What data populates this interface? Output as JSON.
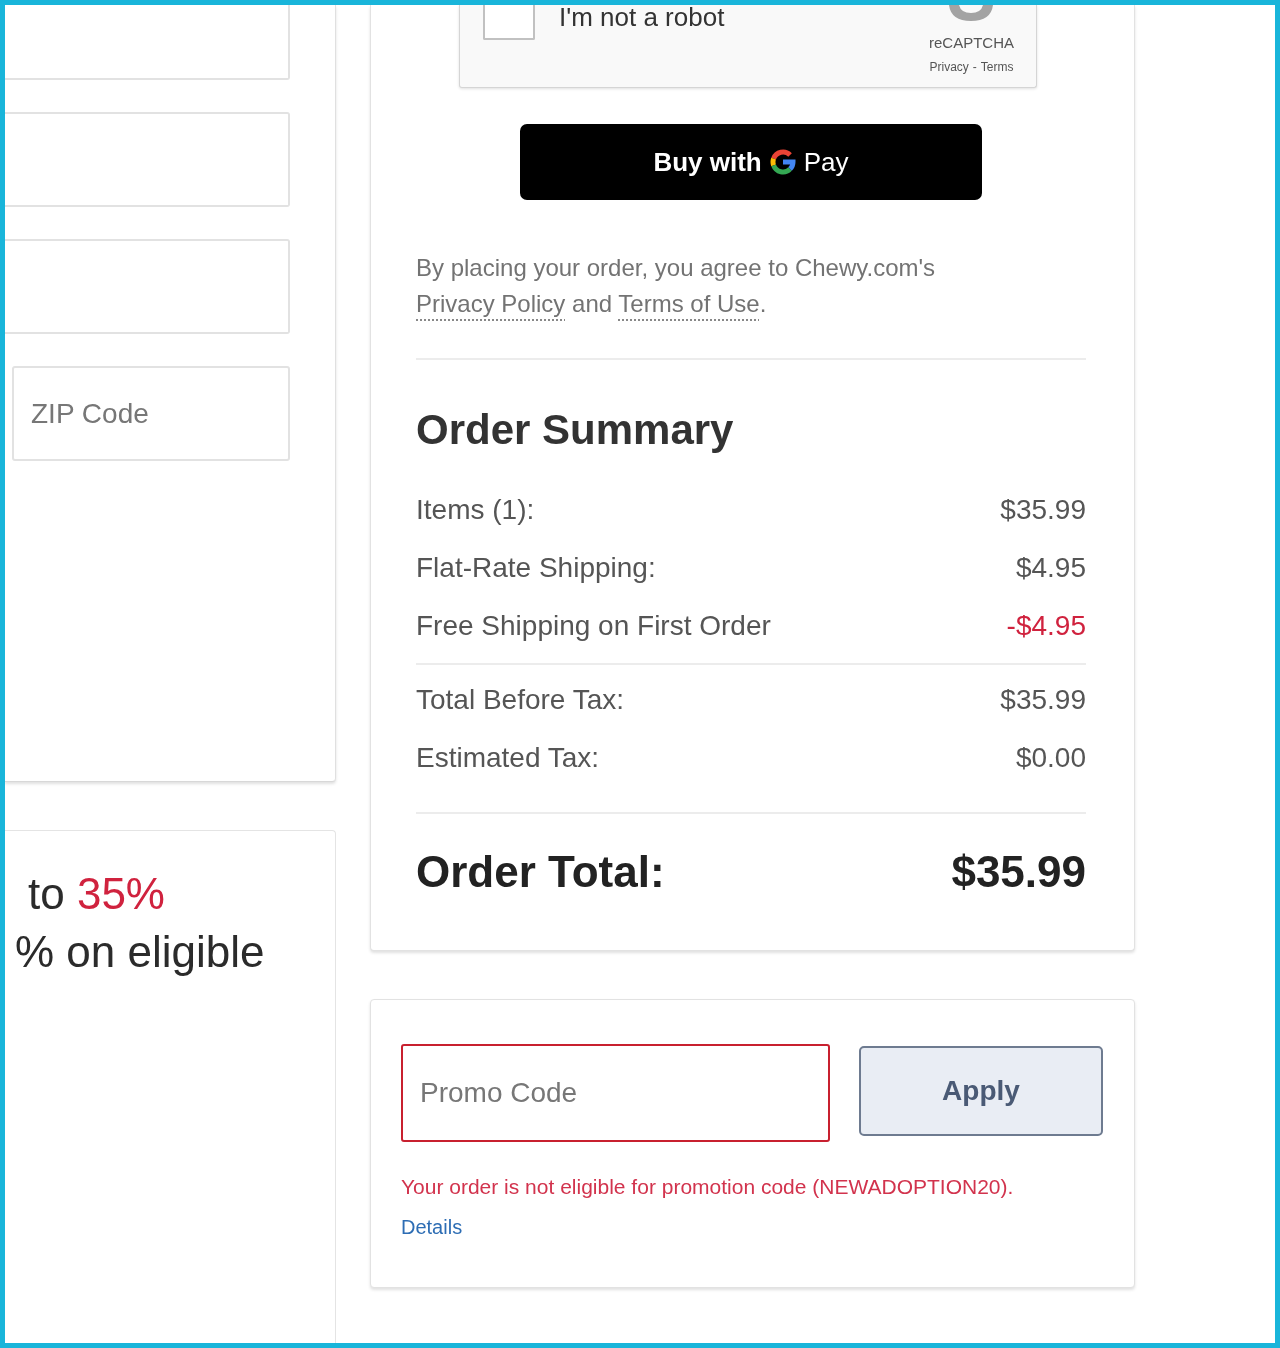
{
  "address_form": {
    "fields": [
      {
        "kind": "wide"
      },
      {
        "kind": "wide"
      },
      {
        "kind": "wide"
      },
      {
        "kind": "narrow",
        "placeholder": "ZIP Code"
      }
    ]
  },
  "offer": {
    "lines": [
      {
        "segments": [
          {
            "text": "to ",
            "highlight": false
          },
          {
            "text": "35%",
            "highlight": true
          }
        ]
      },
      {
        "segments": [
          {
            "text": "% on eligible",
            "highlight": false
          }
        ]
      }
    ]
  },
  "recaptcha": {
    "label": "I'm not a robot",
    "checked": false,
    "brand": "reCAPTCHA",
    "links": [
      "Privacy",
      "Terms"
    ],
    "link_separator": "-"
  },
  "pay_button": {
    "label_before": "Buy with",
    "label_after": "Pay"
  },
  "agreement": {
    "segments": [
      {
        "text": "By placing your order, you agree to Chewy.com's ",
        "link": false
      },
      {
        "text": "Privacy Policy",
        "link": true
      },
      {
        "text": " and ",
        "link": false
      },
      {
        "text": "Terms of Use",
        "link": true
      },
      {
        "text": ".",
        "link": false
      }
    ]
  },
  "order_summary": {
    "title": "Order Summary",
    "groups": [
      {
        "rows": [
          {
            "label": "Items (1):",
            "amount": "$35.99",
            "discount": false
          },
          {
            "label": "Flat-Rate Shipping:",
            "amount": "$4.95",
            "discount": false
          },
          {
            "label": "Free Shipping on First Order",
            "amount": "-$4.95",
            "discount": true
          }
        ]
      },
      {
        "rows": [
          {
            "label": "Total Before Tax:",
            "amount": "$35.99",
            "discount": false
          },
          {
            "label": "Estimated Tax:",
            "amount": "$0.00",
            "discount": false
          }
        ]
      }
    ],
    "total": {
      "label": "Order Total:",
      "amount": "$35.99"
    }
  },
  "promo": {
    "field": {
      "placeholder": "Promo Code",
      "invalid": true
    },
    "button": "Apply",
    "error": "Your order is not eligible for promotion code (NEWADOPTION20).",
    "details_link": "Details"
  }
}
